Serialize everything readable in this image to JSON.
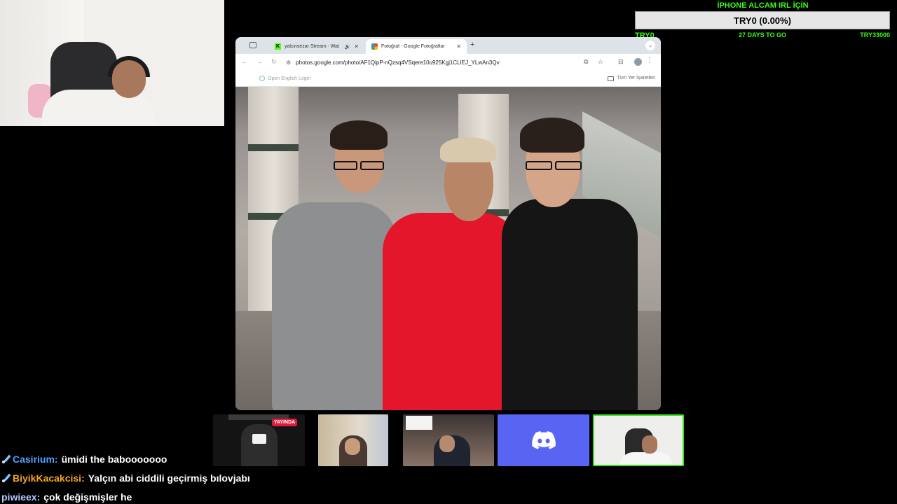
{
  "goal": {
    "title": "İPHONE ALCAM IRL İÇİN",
    "bar_text": "TRY0 (0.00%)",
    "progress_fraction": 0.0,
    "start": "TRY0",
    "days": "27 DAYS TO GO",
    "end": "TRY33000",
    "color": "#39ff14"
  },
  "browser": {
    "tabs": [
      {
        "title": "yalcinsezar Stream - Wat",
        "favicon": "kick-icon",
        "active": false
      },
      {
        "title": "Fotoğraf - Google Fotoğraflar",
        "favicon": "google-photos-icon",
        "active": true
      }
    ],
    "url": "photos.google.com/photo/AF1QipP-nQzsq4VSqere10u925Kgj1CLIEJ_YLwAn3Qv",
    "bookmark": "Open English Login",
    "bookmarks_folder": "Tüm Yer İşaretleri"
  },
  "stream": {
    "live_badge": "YAYINDA",
    "discord_color": "#5865f2",
    "active_border_color": "#35e61b"
  },
  "chat": [
    {
      "user": "Casirium:",
      "user_color": "#4fa3ff",
      "message": "ümidi the babooooooo",
      "badge": "rocket-icon"
    },
    {
      "user": "BiyikKacakcisi:",
      "user_color": "#f5a623",
      "message": "Yalçın abi ciddili geçirmiş bılovjabı",
      "badge": "rocket-icon"
    },
    {
      "user": "piwieex:",
      "user_color": "#b7c7ff",
      "message": "çok değişmişler he",
      "badge": ""
    }
  ]
}
